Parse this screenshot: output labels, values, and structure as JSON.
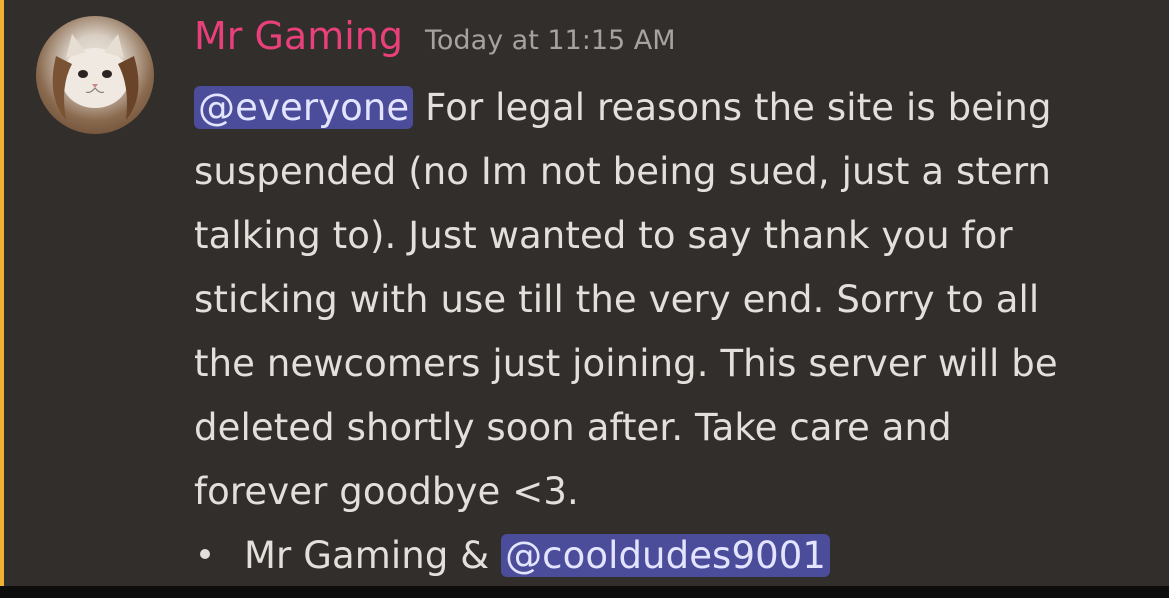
{
  "message": {
    "author": "Mr Gaming",
    "timestamp": "Today at 11:15 AM",
    "mention_everyone": "@everyone",
    "lines": [
      " For legal reasons the site is being",
      "suspended (no Im not being sued, just a stern",
      "talking to). Just wanted to say thank you for",
      "sticking with use till the very end. Sorry to all",
      "the newcomers just joining. This server will be",
      "deleted shortly soon after. Take care and",
      "forever goodbye <3."
    ],
    "signature_text": "Mr Gaming & ",
    "signature_mention": "@cooldudes9001"
  },
  "colors": {
    "background": "#322e2c",
    "username": "#e8407a",
    "mention_bg": "#4c4d9a",
    "highlight_bar": "#f0b232"
  },
  "icons": {
    "avatar": "cat-avatar-image"
  }
}
